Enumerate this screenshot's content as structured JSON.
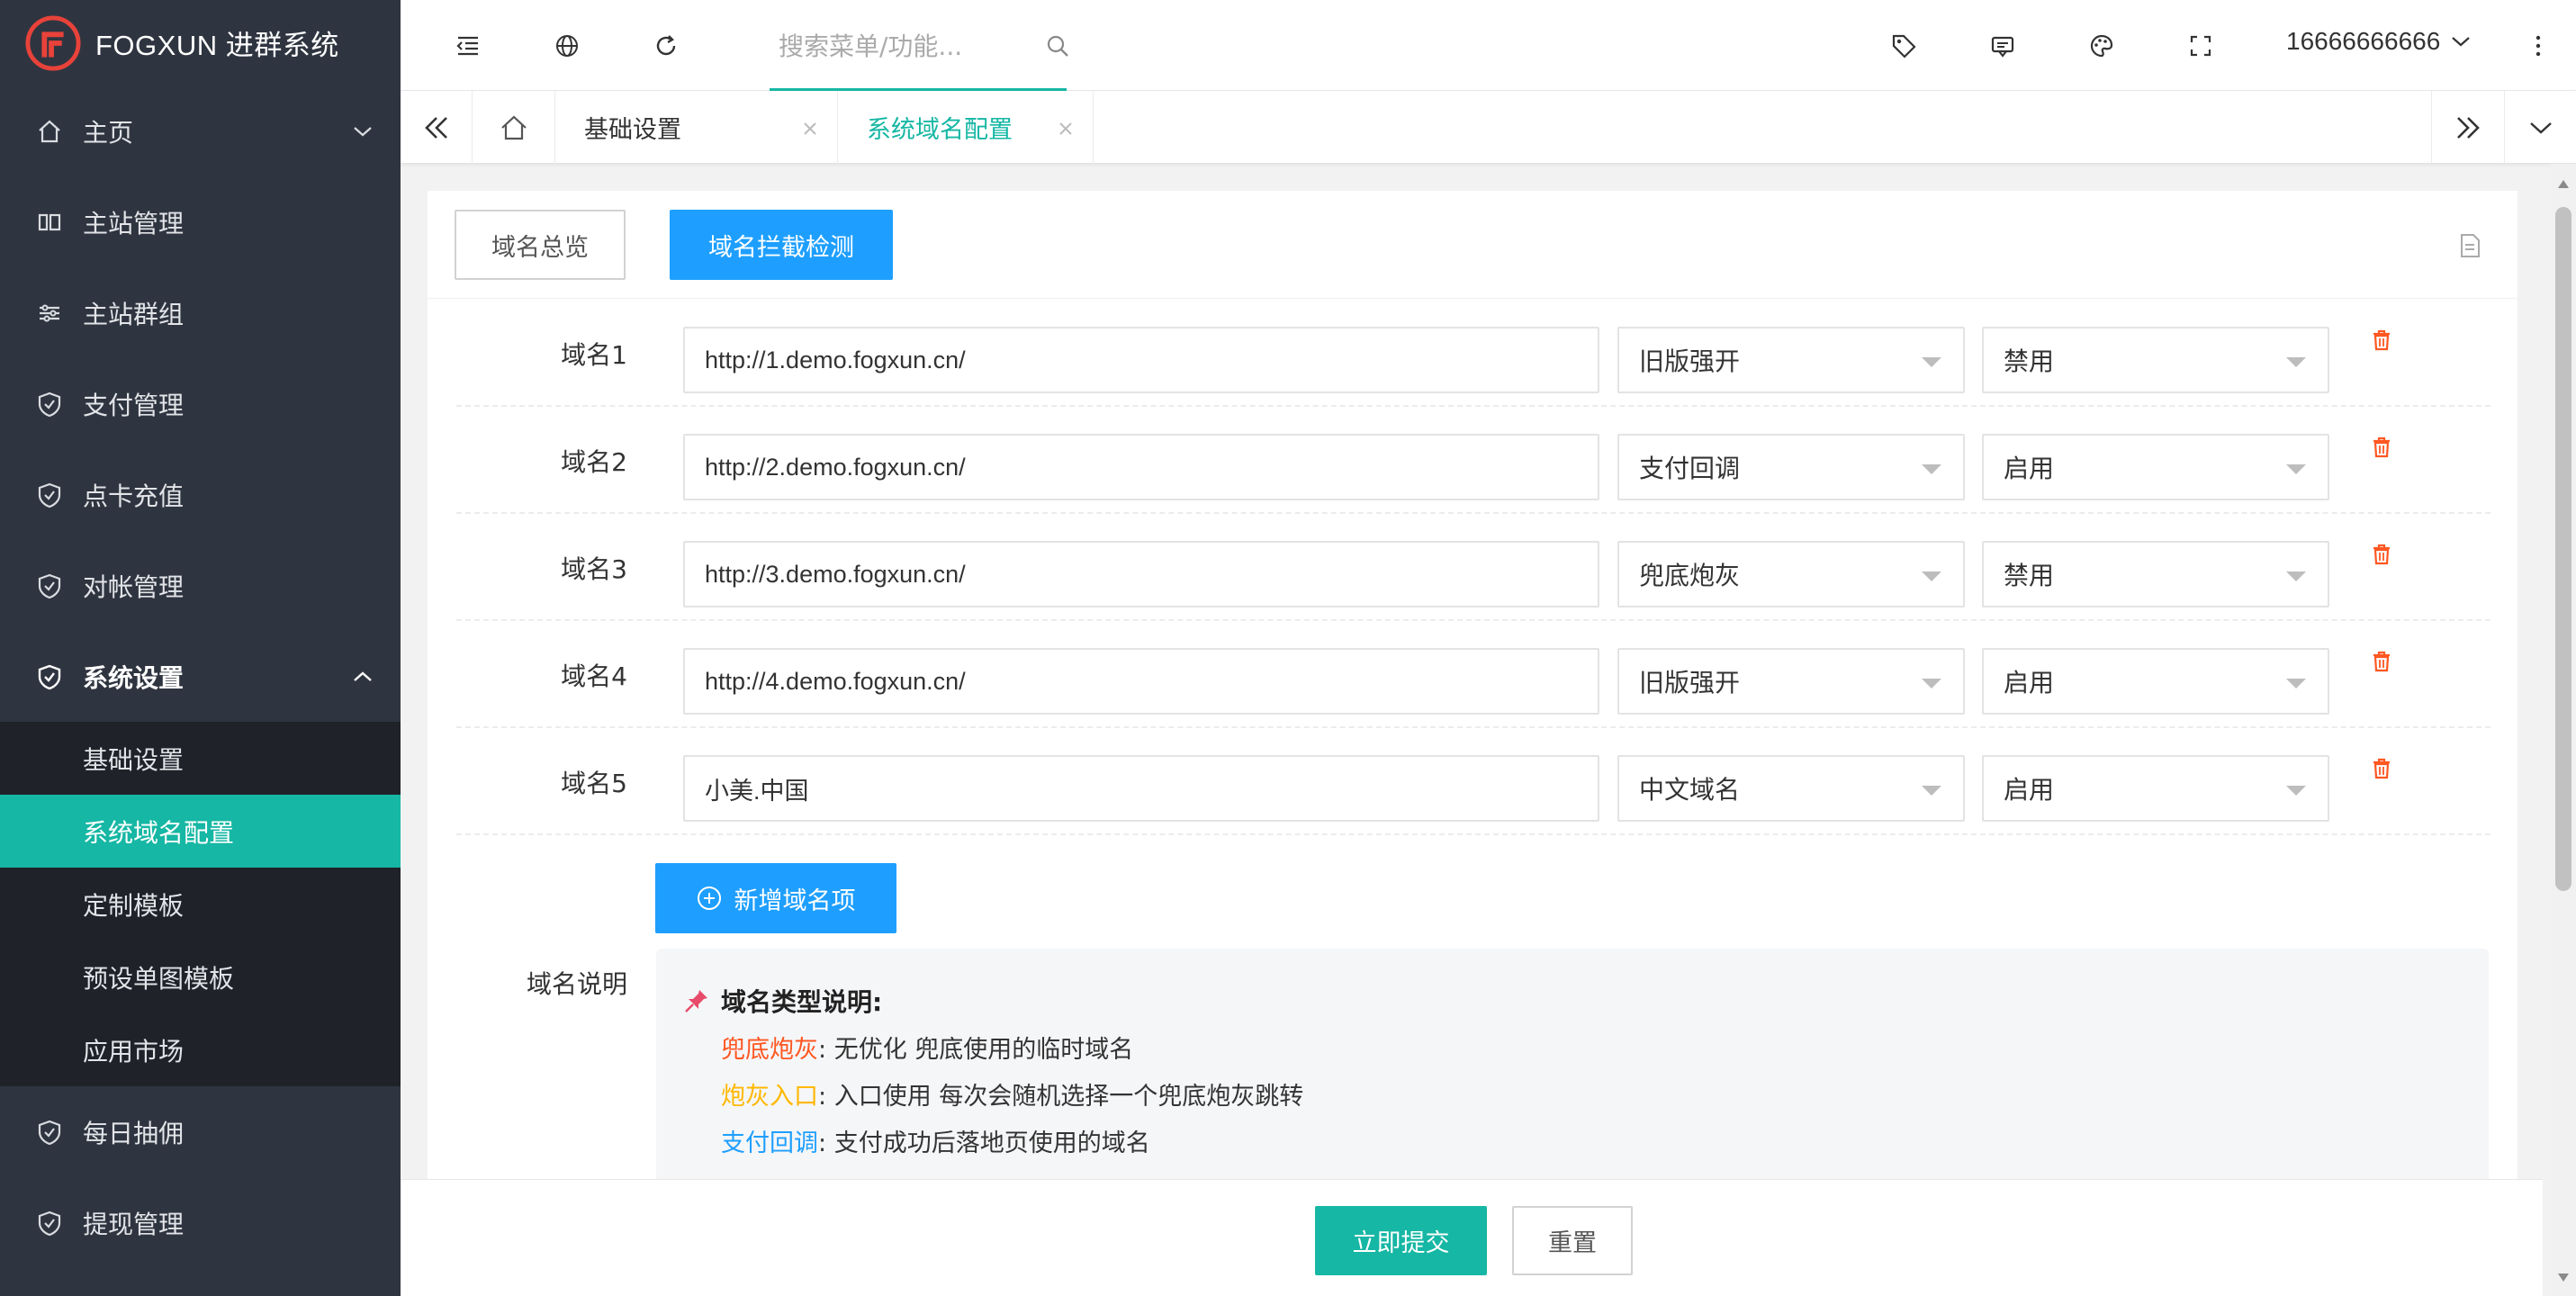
{
  "brand": {
    "name": "FOGXUN 进群系统",
    "accent": "#16b7a4",
    "logo_color": "#e8423a"
  },
  "sidebar": {
    "items": [
      {
        "label": "主页",
        "icon": "home-icon",
        "chevron": "down"
      },
      {
        "label": "主站管理",
        "icon": "columns-icon"
      },
      {
        "label": "主站群组",
        "icon": "sliders-icon"
      },
      {
        "label": "支付管理",
        "icon": "shield-check-icon"
      },
      {
        "label": "点卡充值",
        "icon": "shield-check-icon"
      },
      {
        "label": "对帐管理",
        "icon": "shield-check-icon"
      },
      {
        "label": "系统设置",
        "icon": "shield-check-icon",
        "chevron": "up",
        "expanded": true
      }
    ],
    "sub_items": [
      {
        "label": "基础设置"
      },
      {
        "label": "系统域名配置",
        "current": true
      },
      {
        "label": "定制模板"
      },
      {
        "label": "预设单图模板"
      },
      {
        "label": "应用市场"
      }
    ],
    "after_items": [
      {
        "label": "每日抽佣",
        "icon": "shield-check-icon"
      },
      {
        "label": "提现管理",
        "icon": "shield-check-icon"
      }
    ]
  },
  "header": {
    "search_placeholder": "搜索菜单/功能...",
    "user": "16666666666",
    "icons": [
      "menu-fold-icon",
      "globe-icon",
      "refresh-icon",
      "search-icon",
      "tag-icon",
      "message-icon",
      "palette-icon",
      "fullscreen-icon",
      "more-vertical-icon"
    ]
  },
  "tabs": {
    "items": [
      {
        "label": "基础设置"
      },
      {
        "label": "系统域名配置",
        "current": true
      }
    ]
  },
  "main": {
    "head_buttons": {
      "overview": "域名总览",
      "check": "域名拦截检测"
    },
    "rows": [
      {
        "label": "域名1",
        "url": "http://1.demo.fogxun.cn/",
        "type": "旧版强开",
        "status": "禁用"
      },
      {
        "label": "域名2",
        "url": "http://2.demo.fogxun.cn/",
        "type": "支付回调",
        "status": "启用"
      },
      {
        "label": "域名3",
        "url": "http://3.demo.fogxun.cn/",
        "type": "兜底炮灰",
        "status": "禁用"
      },
      {
        "label": "域名4",
        "url": "http://4.demo.fogxun.cn/",
        "type": "旧版强开",
        "status": "启用"
      },
      {
        "label": "域名5",
        "url": "小美.中国",
        "type": "中文域名",
        "status": "启用"
      }
    ],
    "add_button": "新增域名项",
    "note": {
      "label": "域名说明",
      "title": "域名类型说明:",
      "lines": [
        {
          "key": "兜底炮灰",
          "sep": ":",
          "text": "无优化 兜底使用的临时域名",
          "color": "#ff5722"
        },
        {
          "key": "炮灰入口",
          "sep": ":",
          "text": "入口使用 每次会随机选择一个兜底炮灰跳转",
          "color": "#ffb800"
        },
        {
          "key": "支付回调",
          "sep": ":",
          "text": "支付成功后落地页使用的域名",
          "color": "#1e9fff"
        }
      ]
    }
  },
  "footer": {
    "submit": "立即提交",
    "reset": "重置"
  }
}
